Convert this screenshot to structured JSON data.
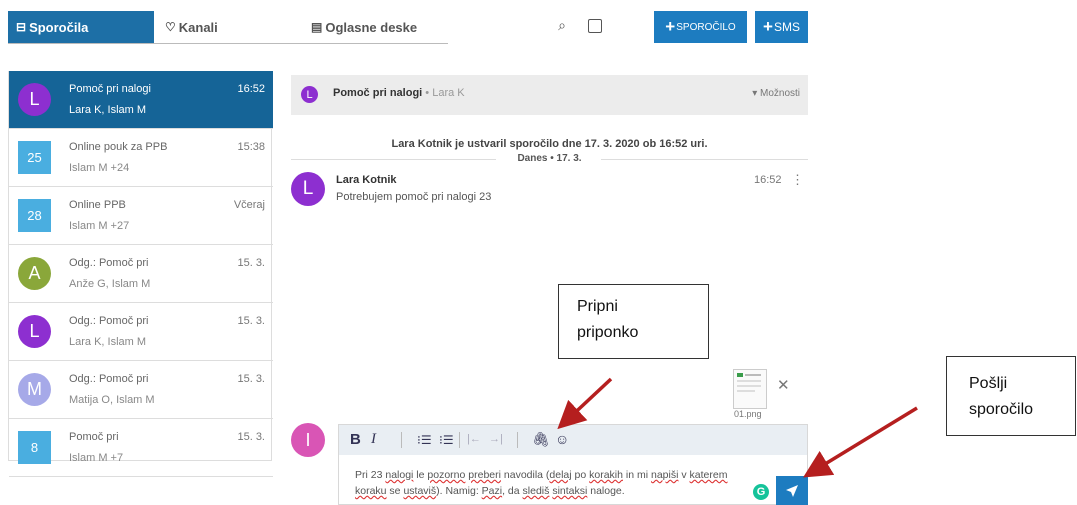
{
  "tabs": {
    "messages": "Sporočila",
    "channels": "Kanali",
    "boards": "Oglasne deske"
  },
  "toolbar": {
    "new_message": "SPOROČILO",
    "sms": "SMS"
  },
  "conversations": [
    {
      "avatar": "L",
      "avatar_color": "#8d2fd0",
      "title": "Pomoč pri nalogi",
      "participants": "Lara K, Islam M",
      "time": "16:52",
      "active": true
    },
    {
      "avatar": "25",
      "avatar_color": "#4aaee0",
      "title": "Online pouk za PPB",
      "participants": "Islam M +24",
      "time": "15:38"
    },
    {
      "avatar": "28",
      "avatar_color": "#4aaee0",
      "title": "Online PPB",
      "participants": "Islam M +27",
      "time": "Včeraj"
    },
    {
      "avatar": "A",
      "avatar_color": "#8aa73a",
      "title": "Odg.: Pomoč pri",
      "participants": "Anže G, Islam M",
      "time": "15. 3."
    },
    {
      "avatar": "L",
      "avatar_color": "#8d2fd0",
      "title": "Odg.: Pomoč pri",
      "participants": "Lara K, Islam M",
      "time": "15. 3."
    },
    {
      "avatar": "M",
      "avatar_color": "#a6a9e8",
      "title": "Odg.: Pomoč pri",
      "participants": "Matija O, Islam M",
      "time": "15. 3."
    },
    {
      "avatar": "8",
      "avatar_color": "#4aaee0",
      "title": "Pomoč pri",
      "participants": "Islam M +7",
      "time": "15. 3."
    }
  ],
  "conversation": {
    "avatar": "L",
    "title": "Pomoč pri nalogi",
    "author_suffix": "• Lara K",
    "options": "▾ Možnosti",
    "system_message": "Lara Kotnik je ustvaril sporočilo dne 17. 3. 2020 ob 16:52 uri.",
    "date_separator": "Danes • 17. 3.",
    "message": {
      "avatar": "L",
      "author": "Lara Kotnik",
      "text": "Potrebujem pomoč pri nalogi 23",
      "time": "16:52"
    }
  },
  "attachment": {
    "filename": "01.png"
  },
  "composer": {
    "avatar": "I",
    "text_parts": [
      {
        "t": "Pri 23 ",
        "u": false
      },
      {
        "t": "nalogi",
        "u": true
      },
      {
        "t": " le ",
        "u": false
      },
      {
        "t": "pozorno",
        "u": true
      },
      {
        "t": " ",
        "u": false
      },
      {
        "t": "preberi",
        "u": true
      },
      {
        "t": " navodila (",
        "u": false
      },
      {
        "t": "delaj",
        "u": true
      },
      {
        "t": " po ",
        "u": false
      },
      {
        "t": "korakih",
        "u": true
      },
      {
        "t": " in mi ",
        "u": false
      },
      {
        "t": "napiši",
        "u": true
      },
      {
        "t": " v ",
        "u": false
      },
      {
        "t": "katerem",
        "u": true
      },
      {
        "t": " ",
        "u": false
      },
      {
        "t": "koraku",
        "u": true
      },
      {
        "t": " se ",
        "u": false
      },
      {
        "t": "ustaviš",
        "u": true
      },
      {
        "t": "). Namig: ",
        "u": false
      },
      {
        "t": "Pazi",
        "u": true
      },
      {
        "t": ", da ",
        "u": false
      },
      {
        "t": "slediš",
        "u": true
      },
      {
        "t": " ",
        "u": false
      },
      {
        "t": "sintaksi",
        "u": true
      },
      {
        "t": " naloge.",
        "u": false
      }
    ]
  },
  "callouts": {
    "attach_line1": "Pripni",
    "attach_line2": "priponko",
    "send_line1": "Pošlji",
    "send_line2": "sporočilo"
  },
  "colors": {
    "primary": "#1d7cc0",
    "active_row": "#156497",
    "annotation_arrow": "#b51f1f"
  }
}
